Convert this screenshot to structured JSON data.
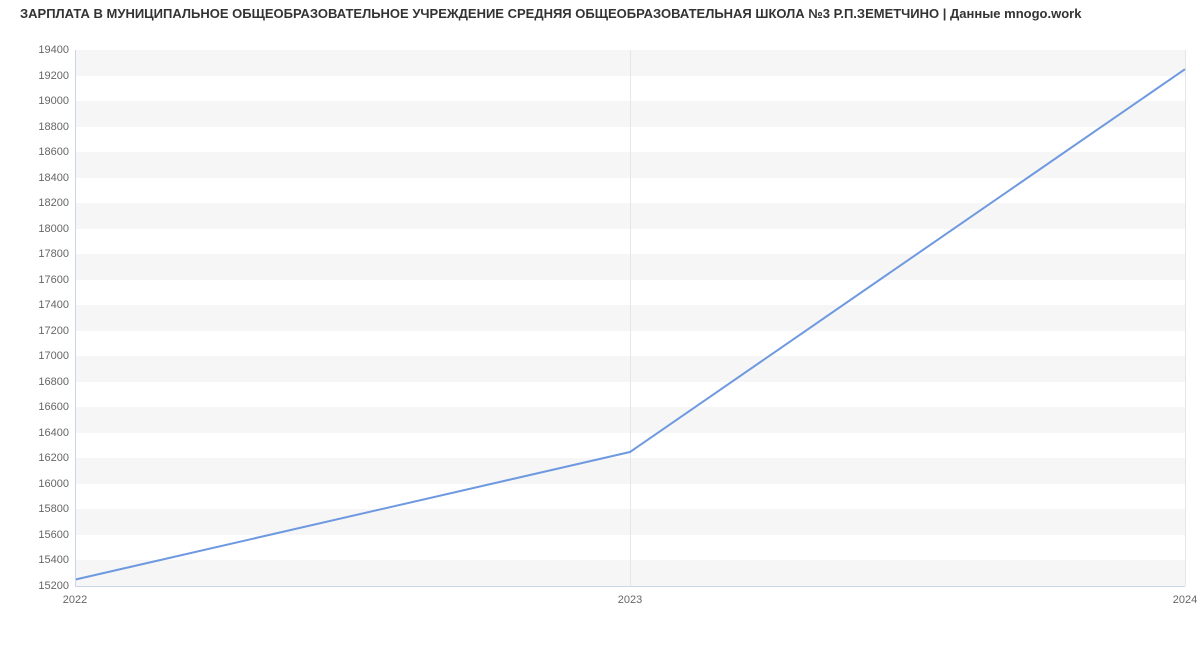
{
  "chart_data": {
    "type": "line",
    "title": "ЗАРПЛАТА В МУНИЦИПАЛЬНОЕ ОБЩЕОБРАЗОВАТЕЛЬНОЕ УЧРЕЖДЕНИЕ СРЕДНЯЯ ОБЩЕОБРАЗОВАТЕЛЬНАЯ ШКОЛА №3 Р.П.ЗЕМЕТЧИНО | Данные mnogo.work",
    "x": [
      2022,
      2023,
      2024
    ],
    "values": [
      15250,
      16250,
      19250
    ],
    "xlabel": "",
    "ylabel": "",
    "ylim": [
      15200,
      19400
    ],
    "y_ticks": [
      15200,
      15400,
      15600,
      15800,
      16000,
      16200,
      16400,
      16600,
      16800,
      17000,
      17200,
      17400,
      17600,
      17800,
      18000,
      18200,
      18400,
      18600,
      18800,
      19000,
      19200,
      19400
    ],
    "x_ticks": [
      2022,
      2023,
      2024
    ],
    "series_color": "#6e99e0",
    "grid": true
  }
}
